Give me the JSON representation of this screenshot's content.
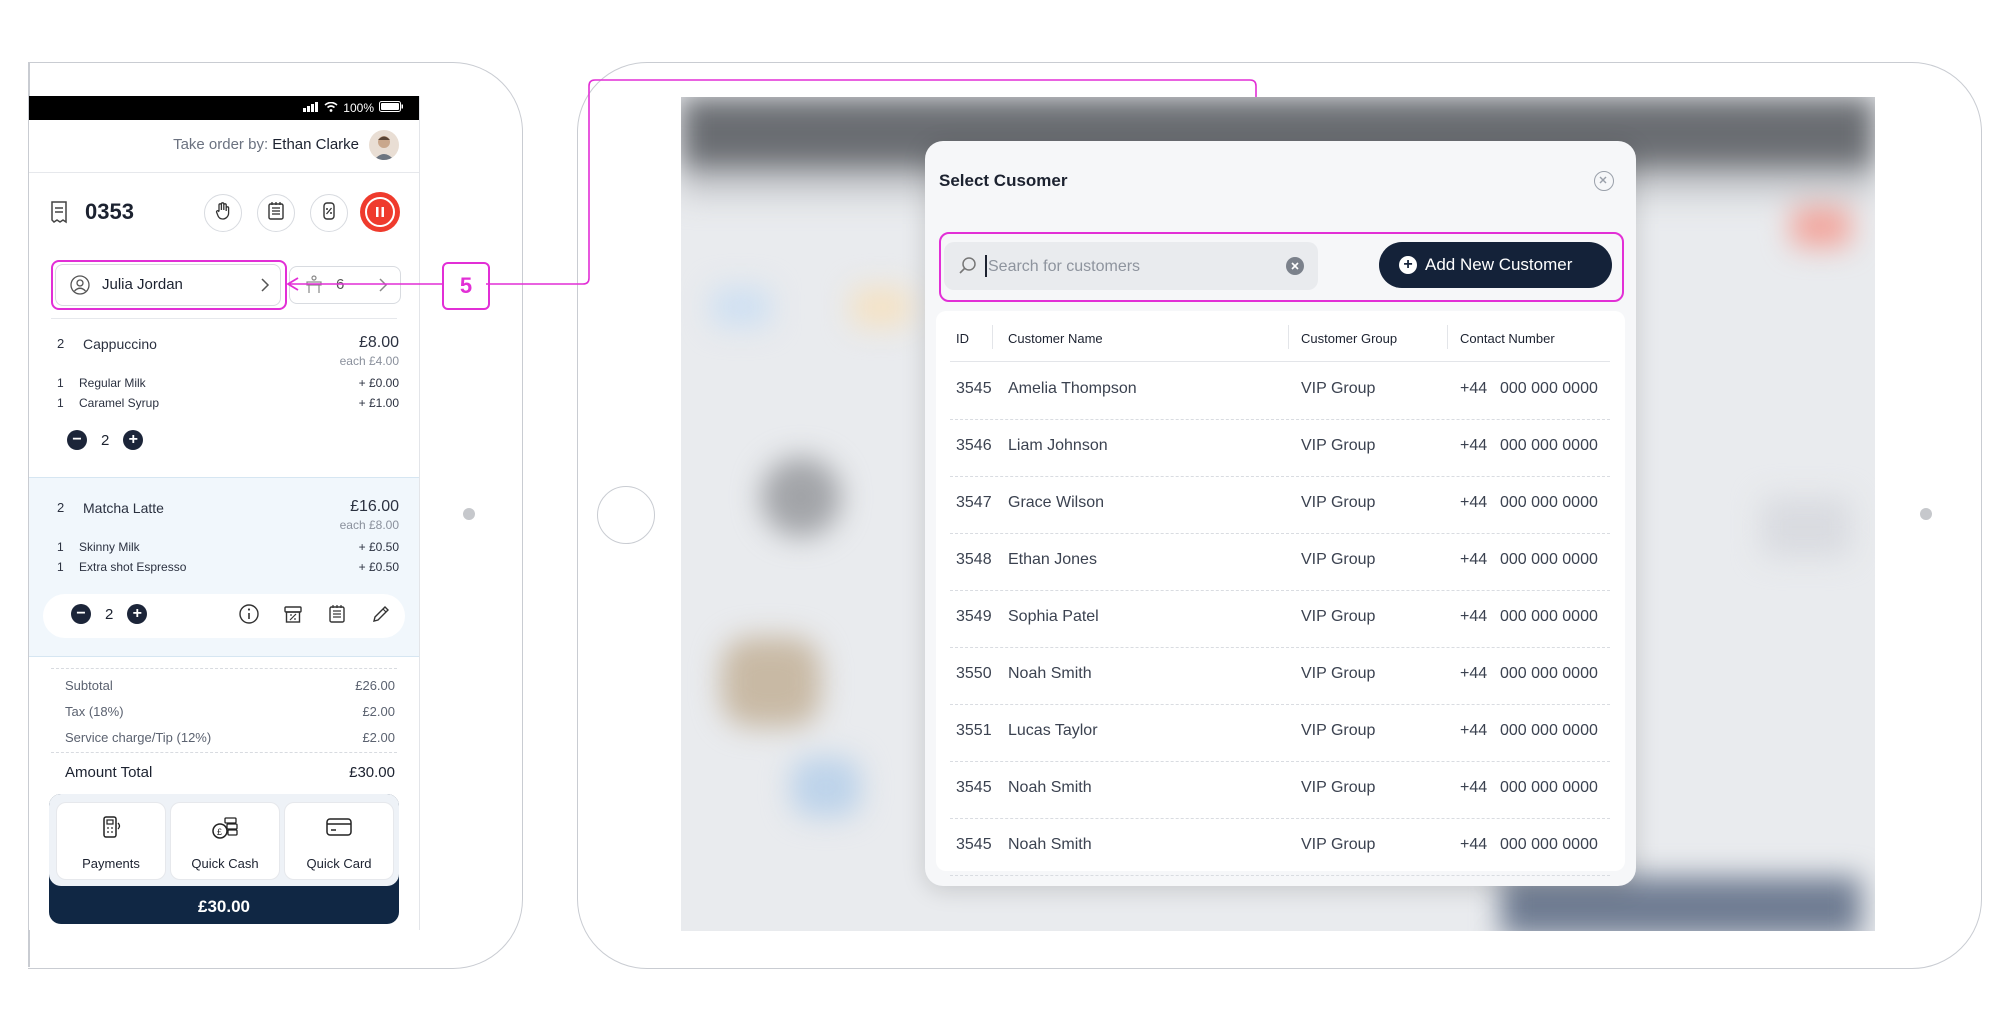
{
  "phone": {
    "status": {
      "battery": "100%"
    },
    "take_order_label": "Take order by:",
    "take_order_name": "Ethan Clarke",
    "order_number": "0353",
    "customer_name": "Julia Jordan",
    "table_number": "6",
    "items": [
      {
        "qty": "2",
        "name": "Cappuccino",
        "price": "£8.00",
        "each": "each £4.00",
        "modifiers": [
          {
            "qty": "1",
            "name": "Regular Milk",
            "price": "+ £0.00"
          },
          {
            "qty": "1",
            "name": "Caramel Syrup",
            "price": "+ £1.00"
          }
        ],
        "stepper_value": "2"
      },
      {
        "qty": "2",
        "name": "Matcha Latte",
        "price": "£16.00",
        "each": "each £8.00",
        "modifiers": [
          {
            "qty": "1",
            "name": "Skinny Milk",
            "price": "+ £0.50"
          },
          {
            "qty": "1",
            "name": "Extra shot Espresso",
            "price": "+ £0.50"
          }
        ],
        "stepper_value": "2"
      }
    ],
    "summary": {
      "subtotal_label": "Subtotal",
      "subtotal": "£26.00",
      "tax_label": "Tax (18%)",
      "tax": "£2.00",
      "service_label": "Service charge/Tip (12%)",
      "service": "£2.00",
      "total_label": "Amount Total",
      "total": "£30.00"
    },
    "pay_buttons": {
      "payments": "Payments",
      "quick_cash": "Quick Cash",
      "quick_card": "Quick Card"
    },
    "pay_total": "£30.00"
  },
  "annotation": {
    "step": "5"
  },
  "modal": {
    "title": "Select Cusomer",
    "search_placeholder": "Search for customers",
    "search_value": "",
    "add_button": "Add New Customer",
    "columns": [
      "ID",
      "Customer Name",
      "Customer Group",
      "Contact Number"
    ],
    "rows": [
      {
        "id": "3545",
        "name": "Amelia Thompson",
        "group": "VIP Group",
        "code": "+44",
        "number": "000 000 0000"
      },
      {
        "id": "3546",
        "name": "Liam Johnson",
        "group": "VIP Group",
        "code": "+44",
        "number": "000 000 0000"
      },
      {
        "id": "3547",
        "name": "Grace Wilson",
        "group": "VIP Group",
        "code": "+44",
        "number": "000 000 0000"
      },
      {
        "id": "3548",
        "name": "Ethan Jones",
        "group": "VIP Group",
        "code": "+44",
        "number": "000 000 0000"
      },
      {
        "id": "3549",
        "name": "Sophia Patel",
        "group": "VIP Group",
        "code": "+44",
        "number": "000 000 0000"
      },
      {
        "id": "3550",
        "name": "Noah Smith",
        "group": "VIP Group",
        "code": "+44",
        "number": "000 000 0000"
      },
      {
        "id": "3551",
        "name": "Lucas Taylor",
        "group": "VIP Group",
        "code": "+44",
        "number": "000 000 0000"
      },
      {
        "id": "3545",
        "name": "Noah Smith",
        "group": "VIP Group",
        "code": "+44",
        "number": "000 000 0000"
      },
      {
        "id": "3545",
        "name": "Noah Smith",
        "group": "VIP Group",
        "code": "+44",
        "number": "000 000 0000"
      }
    ]
  },
  "colors": {
    "accent_magenta": "#e22fd6",
    "navy": "#142239",
    "pause_red": "#ef3b2d"
  }
}
